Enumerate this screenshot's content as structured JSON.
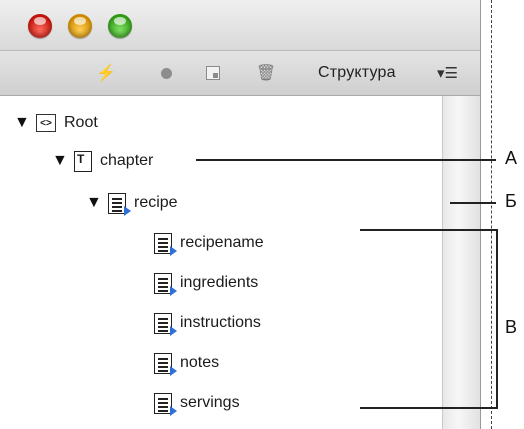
{
  "toolbar": {
    "bolt_icon": "⚡",
    "trash_icon": "🗑",
    "panel_label": "Структура",
    "menu_icon": "▾☰"
  },
  "tree": {
    "twisty": "▼",
    "root": {
      "label": "Root",
      "icon": "<>"
    },
    "chapter": {
      "label": "chapter",
      "icon": "T"
    },
    "recipe": {
      "label": "recipe"
    },
    "children": [
      {
        "label": "recipename"
      },
      {
        "label": "ingredients"
      },
      {
        "label": "instructions"
      },
      {
        "label": "notes"
      },
      {
        "label": "servings"
      }
    ]
  },
  "callouts": {
    "a": "А",
    "b": "Б",
    "c": "В"
  }
}
